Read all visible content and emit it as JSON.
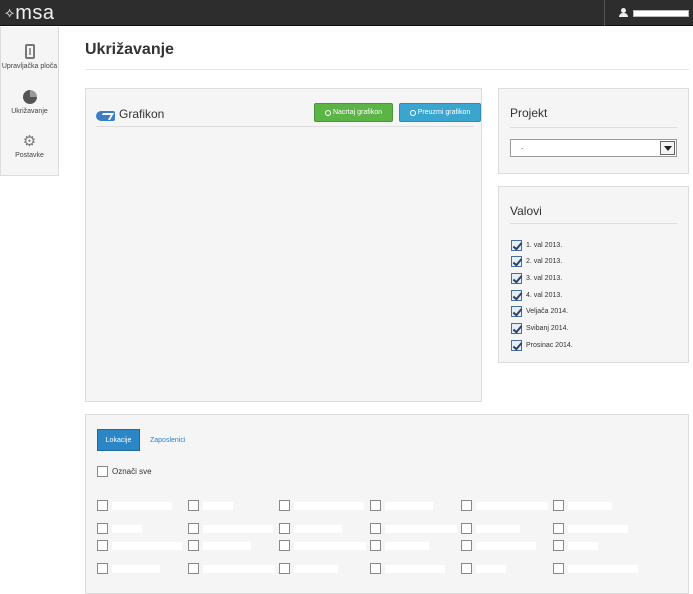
{
  "app": {
    "logo_mark": "⟡",
    "logo_text": "msa"
  },
  "sidebar": {
    "items": [
      {
        "label": "Upravljačka ploča",
        "icon": "phone-icon"
      },
      {
        "label": "Ukrižavanje",
        "icon": "pie-chart-icon"
      },
      {
        "label": "Postavke",
        "icon": "gear-icon"
      }
    ]
  },
  "page": {
    "title": "Ukrižavanje"
  },
  "grafikon": {
    "title": "Grafikon",
    "draw_button": "Nacrtaj grafikon",
    "download_button": "Preuzmi grafikon"
  },
  "projekt": {
    "title": "Projekt",
    "selected": "."
  },
  "valovi": {
    "title": "Valovi",
    "items": [
      {
        "label": "1. val 2013.",
        "checked": true
      },
      {
        "label": "2. val 2013.",
        "checked": true
      },
      {
        "label": "3. val 2013.",
        "checked": true
      },
      {
        "label": "4. val 2013.",
        "checked": true
      },
      {
        "label": "Veljača 2014.",
        "checked": true
      },
      {
        "label": "Svibanj 2014.",
        "checked": true
      },
      {
        "label": "Prosinac 2014.",
        "checked": true
      }
    ]
  },
  "bottom": {
    "tabs": [
      {
        "label": "Lokacije",
        "active": true
      },
      {
        "label": "Zaposlenici",
        "active": false
      }
    ],
    "select_all": "Označi sve"
  },
  "colors": {
    "topbar": "#2d2d2d",
    "green": "#5cb346",
    "blue": "#3aa6d0",
    "tab_active": "#2c86c6"
  }
}
